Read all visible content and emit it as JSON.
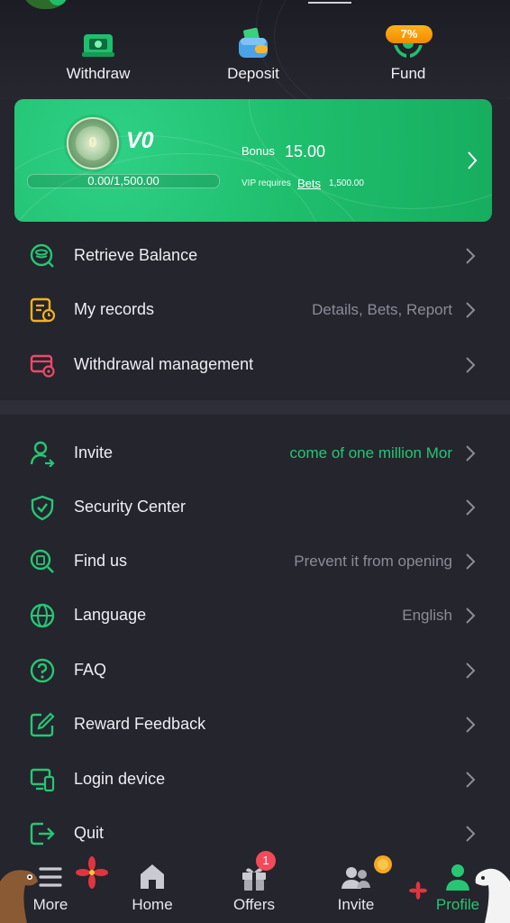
{
  "quick_actions": [
    {
      "label": "Withdraw",
      "icon": "withdraw-icon"
    },
    {
      "label": "Deposit",
      "icon": "wallet-icon"
    },
    {
      "label": "Fund",
      "icon": "fund-hands-icon",
      "badge": "7%"
    }
  ],
  "vip": {
    "level": "V0",
    "badge_text": "0",
    "progress_text": "0.00/1,500.00",
    "progress_fraction": 0,
    "bonus_label": "Bonus",
    "bonus_value": "15.00",
    "requires_prefix": "VIP requires",
    "requires_link": "Bets",
    "requires_amount": "1,500.00"
  },
  "menu_group_1": [
    {
      "label": "Retrieve Balance",
      "value": "",
      "icon": "retrieve-balance-icon"
    },
    {
      "label": "My records",
      "value": "Details, Bets, Report",
      "icon": "records-icon"
    },
    {
      "label": "Withdrawal management",
      "value": "",
      "icon": "withdrawal-management-icon"
    }
  ],
  "menu_group_2": [
    {
      "label": "Invite",
      "value": "come of one million  Mor",
      "icon": "invite-user-icon"
    },
    {
      "label": "Security Center",
      "value": "",
      "icon": "shield-icon"
    },
    {
      "label": "Find us",
      "value": "Prevent it from opening",
      "icon": "find-us-icon"
    },
    {
      "label": "Language",
      "value": "English",
      "icon": "globe-icon"
    },
    {
      "label": "FAQ",
      "value": "",
      "icon": "question-icon"
    },
    {
      "label": "Reward Feedback",
      "value": "",
      "icon": "edit-icon"
    },
    {
      "label": "Login device",
      "value": "",
      "icon": "devices-icon"
    },
    {
      "label": "Quit",
      "value": "",
      "icon": "logout-icon"
    }
  ],
  "bottom_nav": [
    {
      "label": "More",
      "icon": "menu-icon"
    },
    {
      "label": "Home",
      "icon": "home-icon"
    },
    {
      "label": "Offers",
      "icon": "gift-icon",
      "badge": "1"
    },
    {
      "label": "Invite",
      "icon": "users-icon"
    },
    {
      "label": "Profile",
      "icon": "profile-icon",
      "active": true
    }
  ],
  "colors": {
    "background": "#24252d",
    "accent_green": "#26c674",
    "vip_card": "#1fbf6e",
    "badge_orange": "#f08a00",
    "badge_red": "#f34a5a",
    "muted_text": "#8b8c96"
  }
}
